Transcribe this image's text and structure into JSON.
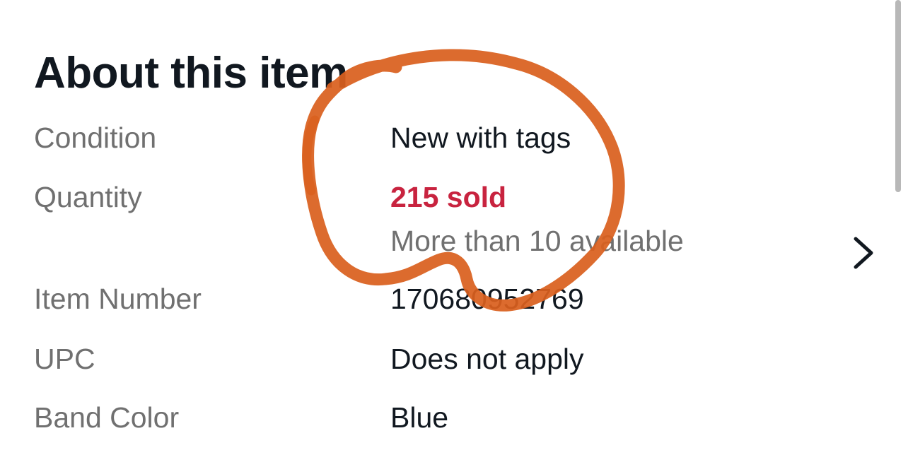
{
  "section": {
    "title": "About this item"
  },
  "specs": {
    "condition": {
      "label": "Condition",
      "value": "New with tags"
    },
    "quantity": {
      "label": "Quantity",
      "sold": "215 sold",
      "available": "More than 10 available"
    },
    "item_number": {
      "label": "Item Number",
      "value": "170680952769"
    },
    "upc": {
      "label": "UPC",
      "value": "Does not apply"
    },
    "band_color": {
      "label": "Band Color",
      "value": "Blue"
    }
  },
  "icons": {
    "chevron": "chevron-right-icon",
    "annotation": "orange-hand-drawn-circle"
  },
  "colors": {
    "sold_red": "#c8233f",
    "annotation_orange": "#d9601e",
    "label_gray": "#707070",
    "text_dark": "#111820"
  }
}
